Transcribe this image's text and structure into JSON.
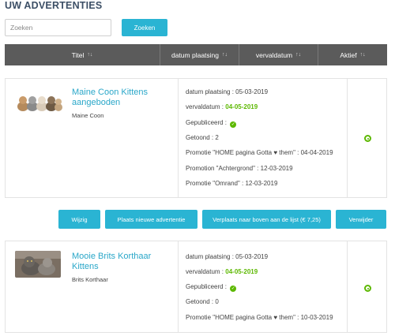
{
  "header": {
    "title": "UW ADVERTENTIES"
  },
  "search": {
    "placeholder": "Zoeken",
    "value": "",
    "button_label": "Zoeken"
  },
  "table": {
    "columns": [
      {
        "label": "Titel",
        "sort": "↑↓"
      },
      {
        "label": "datum plaatsing",
        "sort": "↑↓"
      },
      {
        "label": "vervaldatum",
        "sort": "↑↓"
      },
      {
        "label": "Aktief",
        "sort": "↑↓"
      }
    ]
  },
  "listings": [
    {
      "title": "Maine Coon Kittens aangeboden",
      "breed": "Maine Coon",
      "date_placed": "datum plaatsing : 05-03-2019",
      "expiry_label": "vervaldatum : ",
      "expiry_value": "04-05-2019",
      "published": "Gepubliceerd :",
      "shown": "Getoond : 2",
      "promotions": [
        "Promotie \"HOME pagina Gotta ♥ them\" : 04-04-2019",
        "Promotion \"Achtergrond\" : 12-03-2019",
        "Promotie \"Omrand\" : 12-03-2019"
      ],
      "active": true
    },
    {
      "title": "Mooie Brits Korthaar Kittens",
      "breed": "Brits Korthaar",
      "date_placed": "datum plaatsing : 05-03-2019",
      "expiry_label": "vervaldatum : ",
      "expiry_value": "04-05-2019",
      "published": "Gepubliceerd :",
      "shown": "Getoond : 0",
      "promotions": [
        "Promotie \"HOME pagina Gotta ♥ them\" : 10-03-2019"
      ],
      "active": true
    }
  ],
  "actions": {
    "edit": "Wijzig",
    "new_listing": "Plaats nieuwe advertentie",
    "move_to_top": "Verplaats naar boven aan de lijst (€ 7,25)",
    "delete": "Verwijder"
  },
  "colors": {
    "accent": "#2ab4d3",
    "header_bg": "#5b5b5b",
    "green": "#5cb800",
    "title_link": "#2aa7c9"
  }
}
